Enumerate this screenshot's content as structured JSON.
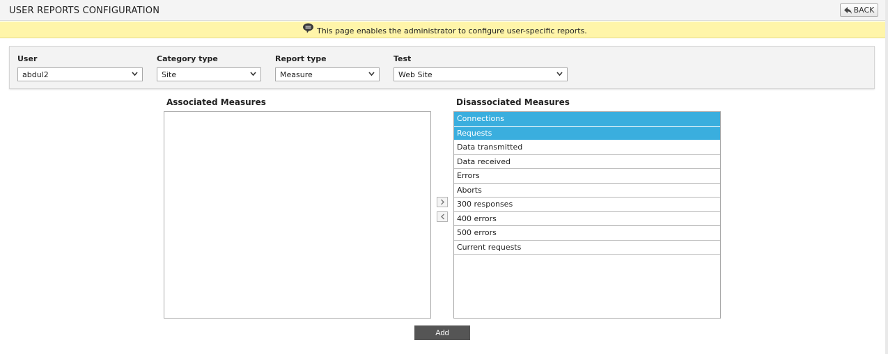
{
  "header": {
    "title": "USER REPORTS CONFIGURATION",
    "back_label": "BACK"
  },
  "info": {
    "message": "This page enables the administrator to configure user-specific reports."
  },
  "filters": {
    "user": {
      "label": "User",
      "value": "abdul2"
    },
    "category_type": {
      "label": "Category type",
      "value": "Site"
    },
    "report_type": {
      "label": "Report type",
      "value": "Measure"
    },
    "test": {
      "label": "Test",
      "value": "Web Site"
    }
  },
  "associated": {
    "heading": "Associated Measures",
    "items": []
  },
  "disassociated": {
    "heading": "Disassociated Measures",
    "items": [
      {
        "label": "Connections",
        "selected": true
      },
      {
        "label": "Requests",
        "selected": true
      },
      {
        "label": "Data transmitted",
        "selected": false
      },
      {
        "label": "Data received",
        "selected": false
      },
      {
        "label": "Errors",
        "selected": false
      },
      {
        "label": "Aborts",
        "selected": false
      },
      {
        "label": "300 responses",
        "selected": false
      },
      {
        "label": "400 errors",
        "selected": false
      },
      {
        "label": "500 errors",
        "selected": false
      },
      {
        "label": "Current requests",
        "selected": false
      }
    ]
  },
  "actions": {
    "add_label": "Add"
  },
  "colors": {
    "selection": "#3aaede",
    "info_bar": "#fff5a9",
    "add_button": "#555555"
  },
  "icons": {
    "back": "back-arrow-icon",
    "info": "speech-bubble-icon",
    "dropdown": "chevron-down-icon",
    "move_right": "chevron-right-icon",
    "move_left": "chevron-left-icon"
  }
}
